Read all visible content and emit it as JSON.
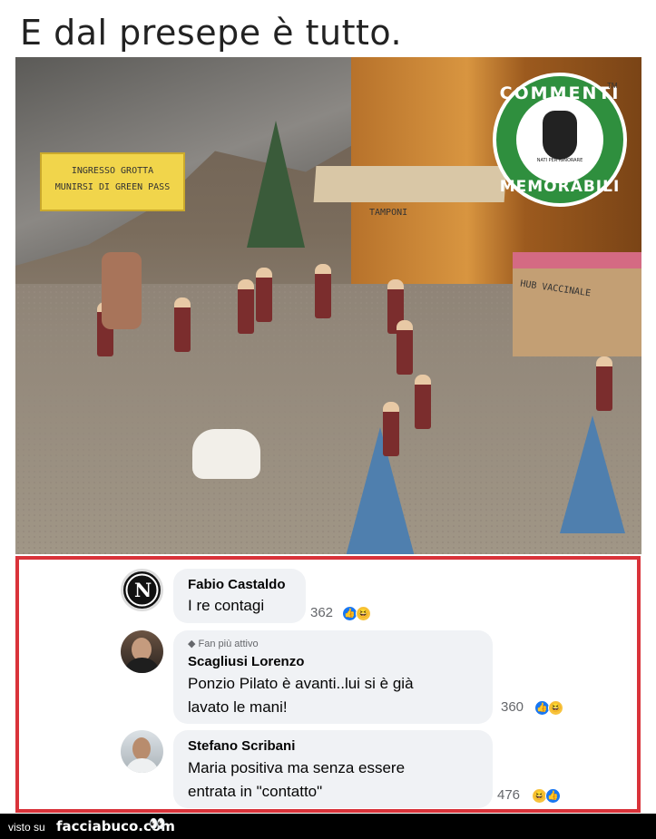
{
  "post": {
    "title": "E dal presepe è tutto."
  },
  "photo": {
    "sign_line1": "INGRESSO GROTTA",
    "sign_line2": "MUNIRSI DI GREEN PASS",
    "tent_label": "TAMPONI",
    "hub_label": "HUB VACCINALE",
    "badge_top": "COMMENTI",
    "badge_bottom": "MEMORABILI",
    "badge_small": "NATI PER IGNORARE",
    "badge_tm": "TM"
  },
  "comments": [
    {
      "author": "Fabio Castaldo",
      "text": "I re contagi",
      "count": "362",
      "reactions": [
        "like",
        "haha"
      ],
      "avatar_icon": "napoli-logo-icon",
      "avatar_letter": "N"
    },
    {
      "author": "Scagliusi Lorenzo",
      "badge": "Fan più attivo",
      "text_line1": "Ponzio Pilato è avanti..lui si è già",
      "text_line2": "lavato le mani!",
      "count": "360",
      "reactions": [
        "like",
        "haha"
      ]
    },
    {
      "author": "Stefano Scribani",
      "text_line1": "Maria positiva ma senza essere",
      "text_line2": "entrata in \"contatto\"",
      "count": "476",
      "reactions": [
        "haha",
        "like"
      ]
    }
  ],
  "footer": {
    "left": "visto su",
    "brand": "facciabuco.com",
    "eyes": "👀"
  },
  "colors": {
    "highlight_border": "#d9333a",
    "like_blue": "#1877f2",
    "haha_yellow": "#f7c33d",
    "badge_green": "#2f8f3e"
  }
}
